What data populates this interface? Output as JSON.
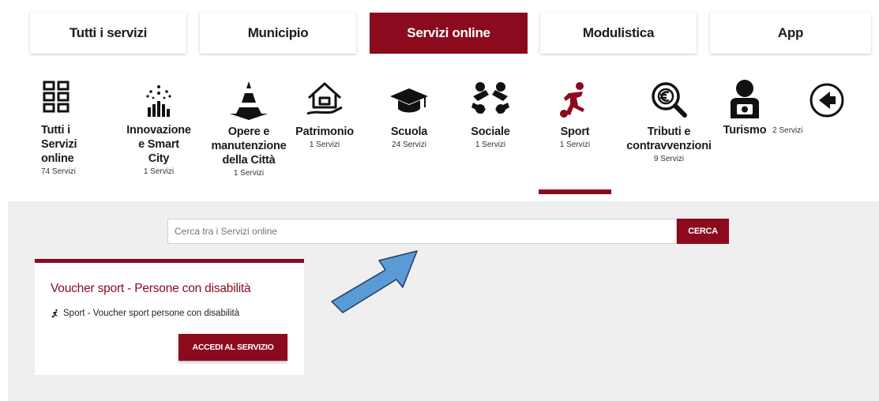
{
  "tabs": [
    {
      "label": "Tutti i servizi",
      "active": false
    },
    {
      "label": "Municipio",
      "active": false
    },
    {
      "label": "Servizi online",
      "active": true
    },
    {
      "label": "Modulistica",
      "active": false
    },
    {
      "label": "App",
      "active": false
    }
  ],
  "categories": {
    "tutti": {
      "label_lines": [
        "Tutti i",
        "Servizi",
        "online"
      ],
      "count": "74 Servizi",
      "icon": "grid-icon"
    },
    "innovazione": {
      "label_lines": [
        "Innovazione",
        "e Smart",
        "City"
      ],
      "count": "1 Servizi",
      "icon": "smart-city-icon"
    },
    "opere": {
      "label_lines": [
        "Opere e",
        "manutenzione",
        "della Città"
      ],
      "count": "1 Servizi",
      "icon": "traffic-cone-icon"
    },
    "patrimonio": {
      "label": "Patrimonio",
      "count": "1 Servizi",
      "icon": "house-hand-icon"
    },
    "scuola": {
      "label": "Scuola",
      "count": "24 Servizi",
      "icon": "graduation-cap-icon"
    },
    "sociale": {
      "label": "Sociale",
      "count": "1 Servizi",
      "icon": "people-circle-icon"
    },
    "sport": {
      "label": "Sport",
      "count": "1 Servizi",
      "icon": "soccer-player-icon",
      "active": true
    },
    "tributi": {
      "label_lines": [
        "Tributi e",
        "contravvenzioni"
      ],
      "count": "9 Servizi",
      "icon": "magnifier-euro-icon"
    },
    "turismo": {
      "label": "Turismo",
      "count": "2 Servizi",
      "icon": "tourist-camera-icon"
    },
    "back": {
      "icon": "back-arrow-icon"
    }
  },
  "search": {
    "placeholder": "Cerca tra i Servizi online",
    "button": "CERCA"
  },
  "card": {
    "title": "Voucher sport - Persone con disabilità",
    "subtitle": "Sport - Voucher sport persone con disabilità",
    "button": "ACCEDI AL SERVIZIO"
  },
  "colors": {
    "brand": "#8b0a1e",
    "band": "#efefef",
    "arrow": "#5b9bd5"
  }
}
